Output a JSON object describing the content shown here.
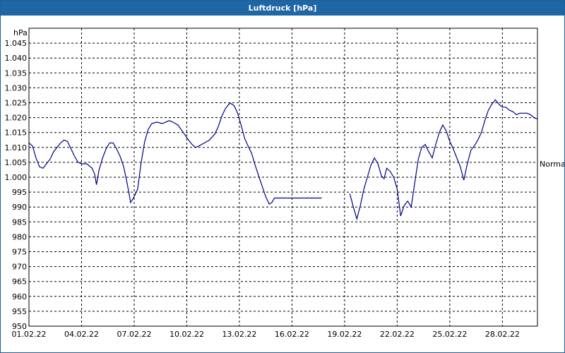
{
  "window": {
    "title": "Luftdruck [hPa]"
  },
  "chart_data": {
    "type": "line",
    "title": "Luftdruck [hPa]",
    "ylabel": "hPa",
    "ylim": [
      950,
      1050
    ],
    "ytick_step": 5,
    "y_tick_labels": [
      "950",
      "955",
      "960",
      "965",
      "970",
      "975",
      "980",
      "985",
      "990",
      "995",
      "1.000",
      "1.005",
      "1.010",
      "1.015",
      "1.020",
      "1.025",
      "1.030",
      "1.035",
      "1.040",
      "1.045"
    ],
    "xlim": [
      0,
      29.0
    ],
    "x_tick_positions": [
      0,
      3,
      6,
      9,
      12,
      15,
      18,
      21,
      24,
      27
    ],
    "x_tick_labels": [
      "01.02.22",
      "04.02.22",
      "07.02.22",
      "10.02.22",
      "13.02.22",
      "16.02.22",
      "19.02.22",
      "22.02.22",
      "25.02.22",
      "28.02.22"
    ],
    "x_unit": "days since 01.02.22 00:00",
    "grid": true,
    "reference_line": {
      "label": "Normal",
      "value": 1004.5
    },
    "line_color": "#00008b",
    "series": [
      {
        "name": "Luftdruck",
        "segments": [
          [
            [
              0.0,
              1011.5
            ],
            [
              0.2,
              1010.5
            ],
            [
              0.4,
              1006.5
            ],
            [
              0.6,
              1003.5
            ],
            [
              0.8,
              1003.0
            ],
            [
              1.0,
              1004.5
            ],
            [
              1.2,
              1006.0
            ],
            [
              1.4,
              1008.5
            ],
            [
              1.6,
              1010.0
            ],
            [
              1.8,
              1011.5
            ],
            [
              2.0,
              1012.5
            ],
            [
              2.2,
              1012.0
            ],
            [
              2.4,
              1009.5
            ],
            [
              2.6,
              1007.0
            ],
            [
              2.8,
              1005.0
            ],
            [
              3.0,
              1004.5
            ],
            [
              3.3,
              1004.5
            ],
            [
              3.6,
              1003.0
            ],
            [
              3.75,
              1001.0
            ],
            [
              3.85,
              997.5
            ],
            [
              4.0,
              1002.5
            ],
            [
              4.2,
              1006.5
            ],
            [
              4.4,
              1009.5
            ],
            [
              4.6,
              1011.5
            ],
            [
              4.8,
              1011.5
            ],
            [
              5.0,
              1009.5
            ],
            [
              5.2,
              1007.0
            ],
            [
              5.4,
              1003.5
            ],
            [
              5.6,
              998.0
            ],
            [
              5.8,
              991.5
            ],
            [
              6.0,
              993.5
            ],
            [
              6.2,
              996.0
            ],
            [
              6.4,
              1005.0
            ],
            [
              6.6,
              1012.0
            ],
            [
              6.8,
              1016.0
            ],
            [
              7.0,
              1018.0
            ],
            [
              7.3,
              1018.5
            ],
            [
              7.6,
              1018.0
            ],
            [
              7.8,
              1018.5
            ],
            [
              8.0,
              1019.0
            ],
            [
              8.2,
              1018.5
            ],
            [
              8.5,
              1017.5
            ],
            [
              8.8,
              1015.0
            ],
            [
              9.1,
              1012.5
            ],
            [
              9.3,
              1011.0
            ],
            [
              9.5,
              1010.0
            ],
            [
              9.7,
              1010.5
            ],
            [
              10.0,
              1011.5
            ],
            [
              10.3,
              1012.5
            ],
            [
              10.6,
              1014.5
            ],
            [
              10.8,
              1017.0
            ],
            [
              11.0,
              1020.5
            ],
            [
              11.2,
              1023.0
            ],
            [
              11.4,
              1024.5
            ],
            [
              11.5,
              1024.8
            ],
            [
              11.7,
              1024.0
            ],
            [
              11.9,
              1021.5
            ],
            [
              12.1,
              1017.5
            ],
            [
              12.3,
              1013.0
            ],
            [
              12.5,
              1010.5
            ],
            [
              12.7,
              1008.0
            ],
            [
              12.9,
              1004.0
            ],
            [
              13.1,
              1000.5
            ],
            [
              13.3,
              997.0
            ],
            [
              13.5,
              993.5
            ],
            [
              13.7,
              991.0
            ],
            [
              13.85,
              991.5
            ],
            [
              14.0,
              993.0
            ],
            [
              14.3,
              993.0
            ],
            [
              14.6,
              993.0
            ],
            [
              15.0,
              993.0
            ],
            [
              15.5,
              993.0
            ],
            [
              16.0,
              993.0
            ],
            [
              16.5,
              993.0
            ],
            [
              16.7,
              993.0
            ]
          ],
          [
            [
              18.3,
              994.5
            ],
            [
              18.5,
              990.0
            ],
            [
              18.7,
              986.0
            ],
            [
              18.9,
              990.5
            ],
            [
              19.1,
              996.0
            ],
            [
              19.3,
              1000.0
            ],
            [
              19.5,
              1004.0
            ],
            [
              19.7,
              1006.5
            ],
            [
              19.9,
              1004.5
            ],
            [
              20.1,
              1000.5
            ],
            [
              20.25,
              999.5
            ],
            [
              20.4,
              1003.0
            ],
            [
              20.6,
              1002.0
            ],
            [
              20.8,
              1000.0
            ],
            [
              21.0,
              996.0
            ],
            [
              21.2,
              987.0
            ],
            [
              21.4,
              990.5
            ],
            [
              21.6,
              992.0
            ],
            [
              21.8,
              990.0
            ],
            [
              22.0,
              998.0
            ],
            [
              22.2,
              1006.0
            ],
            [
              22.4,
              1010.0
            ],
            [
              22.6,
              1011.0
            ],
            [
              22.8,
              1008.5
            ],
            [
              23.0,
              1006.5
            ],
            [
              23.2,
              1011.0
            ],
            [
              23.4,
              1015.0
            ],
            [
              23.6,
              1017.5
            ],
            [
              23.8,
              1015.5
            ],
            [
              24.0,
              1012.0
            ],
            [
              24.2,
              1009.5
            ],
            [
              24.4,
              1006.5
            ],
            [
              24.6,
              1003.5
            ],
            [
              24.8,
              999.0
            ],
            [
              25.0,
              1004.5
            ],
            [
              25.2,
              1009.0
            ],
            [
              25.4,
              1010.5
            ],
            [
              25.6,
              1012.5
            ],
            [
              25.8,
              1015.0
            ],
            [
              26.0,
              1019.0
            ],
            [
              26.2,
              1022.5
            ],
            [
              26.4,
              1024.5
            ],
            [
              26.6,
              1026.0
            ],
            [
              26.8,
              1024.5
            ],
            [
              27.0,
              1023.5
            ],
            [
              27.2,
              1023.5
            ],
            [
              27.4,
              1022.5
            ],
            [
              27.6,
              1022.0
            ],
            [
              27.8,
              1021.0
            ],
            [
              28.0,
              1021.5
            ],
            [
              28.2,
              1021.5
            ],
            [
              28.4,
              1021.5
            ],
            [
              28.6,
              1021.0
            ],
            [
              28.8,
              1020.0
            ],
            [
              29.0,
              1019.5
            ]
          ]
        ]
      }
    ]
  }
}
